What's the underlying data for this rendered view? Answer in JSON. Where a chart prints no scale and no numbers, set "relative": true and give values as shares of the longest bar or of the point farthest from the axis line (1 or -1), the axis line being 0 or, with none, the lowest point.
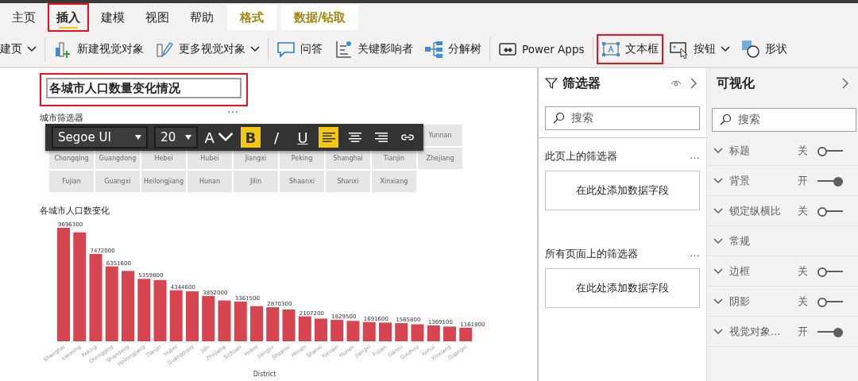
{
  "ribbon": {
    "tabs": [
      {
        "label": "主页",
        "selected": false,
        "contextual": false,
        "highlighted": false
      },
      {
        "label": "插入",
        "selected": true,
        "contextual": false,
        "highlighted": true
      },
      {
        "label": "建模",
        "selected": false,
        "contextual": false,
        "highlighted": false
      },
      {
        "label": "视图",
        "selected": false,
        "contextual": false,
        "highlighted": false
      },
      {
        "label": "帮助",
        "selected": false,
        "contextual": false,
        "highlighted": false
      },
      {
        "label": "格式",
        "selected": false,
        "contextual": true,
        "highlighted": false
      },
      {
        "label": "数据/钻取",
        "selected": false,
        "contextual": true,
        "highlighted": false
      }
    ],
    "groups": [
      [
        {
          "label": "建页",
          "kind": "none",
          "dropdown": true,
          "highlighted": false
        }
      ],
      [
        {
          "label": "新建视觉对象",
          "kind": "new-visual",
          "dropdown": false,
          "highlighted": false
        },
        {
          "label": "更多视觉对象",
          "kind": "more-visuals",
          "dropdown": true,
          "highlighted": false
        }
      ],
      [
        {
          "label": "问答",
          "kind": "qa",
          "dropdown": false,
          "highlighted": false
        },
        {
          "label": "关键影响者",
          "kind": "influencers",
          "dropdown": false,
          "highlighted": false
        },
        {
          "label": "分解树",
          "kind": "tree",
          "dropdown": false,
          "highlighted": false
        }
      ],
      [
        {
          "label": "Power Apps",
          "kind": "apps",
          "dropdown": false,
          "highlighted": false
        }
      ],
      [
        {
          "label": "文本框",
          "kind": "textbox",
          "dropdown": false,
          "highlighted": true
        },
        {
          "label": "按钮",
          "kind": "button",
          "dropdown": true,
          "highlighted": false
        },
        {
          "label": "形状",
          "kind": "shapes",
          "dropdown": false,
          "highlighted": false
        }
      ]
    ]
  },
  "canvas": {
    "text_box": {
      "text": "各城市人口数量变化情况",
      "highlighted": true,
      "more": "…"
    },
    "text_format_toolbar": {
      "font": "Segoe UI",
      "size": "20",
      "buttons": [
        {
          "kind": "font-color",
          "label": "A",
          "on": false
        },
        {
          "kind": "bold",
          "label": "B",
          "on": true
        },
        {
          "kind": "italic",
          "label": "/",
          "on": false
        },
        {
          "kind": "underline",
          "label": "U",
          "on": false
        },
        {
          "kind": "align-left",
          "on": true
        },
        {
          "kind": "align-center",
          "on": false
        },
        {
          "kind": "align-right",
          "on": false
        },
        {
          "kind": "link",
          "on": false
        }
      ]
    },
    "slicer": {
      "title": "城市筛选器",
      "rows": [
        [
          "",
          "",
          "",
          "",
          "",
          "",
          "",
          "",
          "Yunnan"
        ],
        [
          "Chongqing",
          "Guangdong",
          "Hebei",
          "Hubei",
          "Jiangxi",
          "Peking",
          "Shanghai",
          "Tianjin",
          "Zhejiang"
        ],
        [
          "Fujian",
          "Guangxi",
          "Heilongjiang",
          "Hunan",
          "Jilin",
          "Shaanxi",
          "Shanxi",
          "Xinxiang"
        ]
      ]
    },
    "chart": {
      "title": "各城市人口数变化",
      "chart_data": {
        "type": "bar",
        "xlabel": "District",
        "categories": [
          "Shanghai",
          "Liaoning",
          "Peking",
          "Chongqing",
          "Shandong",
          "Heilongjiang",
          "Tianjin",
          "Hubei",
          "Guangdong",
          "Jilin",
          "Zhejiang",
          "Sichuan",
          "Hebei",
          "Jiangsu",
          "Shaanxi",
          "Henan",
          "Shanxi",
          "Yunnan",
          "Hunan",
          "Jiangxi",
          "Fujian",
          "Gansu",
          "Guizhou",
          "Anhui",
          "Xinxiang",
          "Guangxi"
        ],
        "relative": true,
        "series": [
          {
            "color": "#d64550",
            "values": [
              1.0,
              0.96,
              0.77,
              0.66,
              0.62,
              0.55,
              0.54,
              0.45,
              0.44,
              0.4,
              0.36,
              0.35,
              0.31,
              0.3,
              0.28,
              0.22,
              0.2,
              0.19,
              0.18,
              0.17,
              0.165,
              0.16,
              0.15,
              0.14,
              0.13,
              0.12
            ]
          }
        ],
        "value_labels": [
          "9696300",
          null,
          "7472000",
          "6351600",
          null,
          "5359800",
          null,
          "4344600",
          null,
          "3852000",
          null,
          "3361500",
          null,
          "2870300",
          null,
          "2107200",
          null,
          "1829500",
          null,
          "1691600",
          null,
          "1565800",
          null,
          "1369100",
          null,
          "1161800"
        ]
      }
    }
  },
  "filters": {
    "title": "筛选器",
    "search": {
      "placeholder": "搜索"
    },
    "sections": [
      {
        "title": "此页上的筛选器",
        "more": "…",
        "drop_zone": "在此处添加数据字段"
      },
      {
        "title": "所有页面上的筛选器",
        "more": "…",
        "drop_zone": "在此处添加数据字段"
      }
    ]
  },
  "visualizations": {
    "title": "可视化",
    "search": {
      "placeholder": "搜索"
    },
    "cards": [
      {
        "label": "标题",
        "kind": "toggle",
        "state": "关",
        "on": false
      },
      {
        "label": "背景",
        "kind": "toggle",
        "state": "开",
        "on": true
      },
      {
        "label": "锁定纵横比",
        "kind": "toggle",
        "state": "关",
        "on": false
      },
      {
        "label": "常规",
        "kind": "section"
      },
      {
        "label": "边框",
        "kind": "toggle",
        "state": "关",
        "on": false
      },
      {
        "label": "阴影",
        "kind": "toggle",
        "state": "关",
        "on": false
      },
      {
        "label": "视觉对象...",
        "kind": "toggle",
        "state": "开",
        "on": true
      }
    ]
  }
}
